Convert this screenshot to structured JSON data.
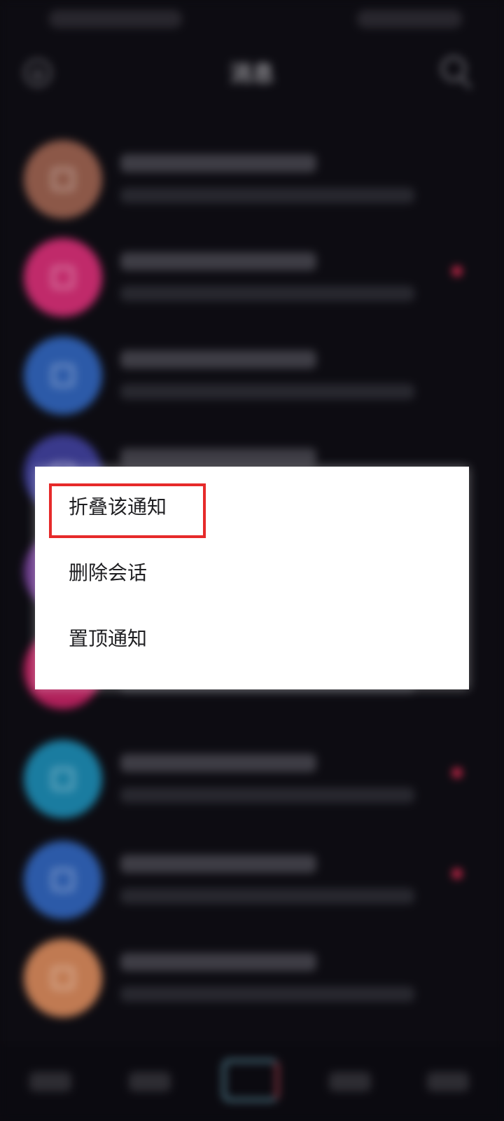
{
  "header": {
    "title": "消息"
  },
  "context_menu": {
    "items": [
      {
        "label": "折叠该通知",
        "highlighted": true
      },
      {
        "label": "删除会话"
      },
      {
        "label": "置顶通知"
      }
    ],
    "highlight_color": "#e62a2a"
  },
  "list": [
    {
      "avatar_color": "#8c5848",
      "unread": false
    },
    {
      "avatar_color": "#c02a6a",
      "unread": true
    },
    {
      "avatar_color": "#2c5aa8",
      "unread": false
    },
    {
      "avatar_color": "#3a3a8c",
      "unread": false
    },
    {
      "avatar_color": "#6a3a8a",
      "unread": false
    },
    {
      "avatar_color": "#b0205a",
      "unread": false
    },
    {
      "avatar_color": "#1a7ca0",
      "unread": true
    },
    {
      "avatar_color": "#2c5aa8",
      "unread": true
    },
    {
      "avatar_color": "#c07a52",
      "unread": false
    }
  ]
}
